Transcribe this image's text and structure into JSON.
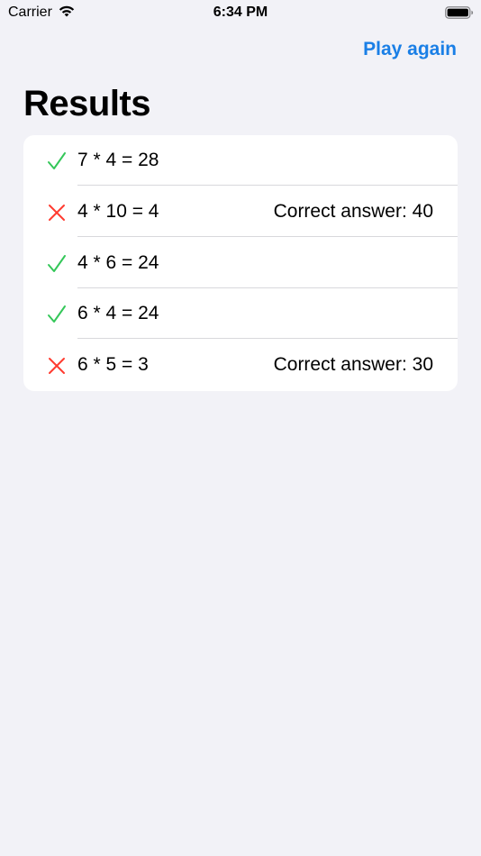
{
  "status_bar": {
    "carrier": "Carrier",
    "time": "6:34 PM"
  },
  "nav": {
    "play_again_label": "Play again"
  },
  "page": {
    "title": "Results"
  },
  "colors": {
    "accent": "#1a7fe6",
    "correct": "#34c759",
    "incorrect": "#ff3b30",
    "background": "#f2f2f7"
  },
  "results": [
    {
      "status": "correct",
      "icon": "checkmark-icon",
      "equation": "7 * 4 = 28",
      "correction": ""
    },
    {
      "status": "incorrect",
      "icon": "xmark-icon",
      "equation": "4 * 10 = 4",
      "correction": "Correct answer: 40"
    },
    {
      "status": "correct",
      "icon": "checkmark-icon",
      "equation": "4 * 6 = 24",
      "correction": ""
    },
    {
      "status": "correct",
      "icon": "checkmark-icon",
      "equation": "6 * 4 = 24",
      "correction": ""
    },
    {
      "status": "incorrect",
      "icon": "xmark-icon",
      "equation": "6 * 5 = 3",
      "correction": "Correct answer: 30"
    }
  ]
}
